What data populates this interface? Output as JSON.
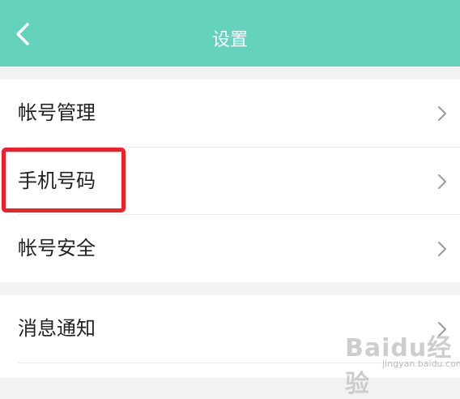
{
  "header": {
    "title": "设置",
    "back_icon": "chevron-left-icon",
    "background": "#64d2bd"
  },
  "settings": {
    "group1": [
      {
        "label": "帐号管理"
      },
      {
        "label": "手机号码"
      },
      {
        "label": "帐号安全"
      }
    ],
    "group2": [
      {
        "label": "消息通知"
      }
    ]
  },
  "annotation": {
    "highlight_color": "#f0202a"
  },
  "watermark": {
    "logo": "Baidu经验",
    "url": "jingyan.baidu.com"
  }
}
